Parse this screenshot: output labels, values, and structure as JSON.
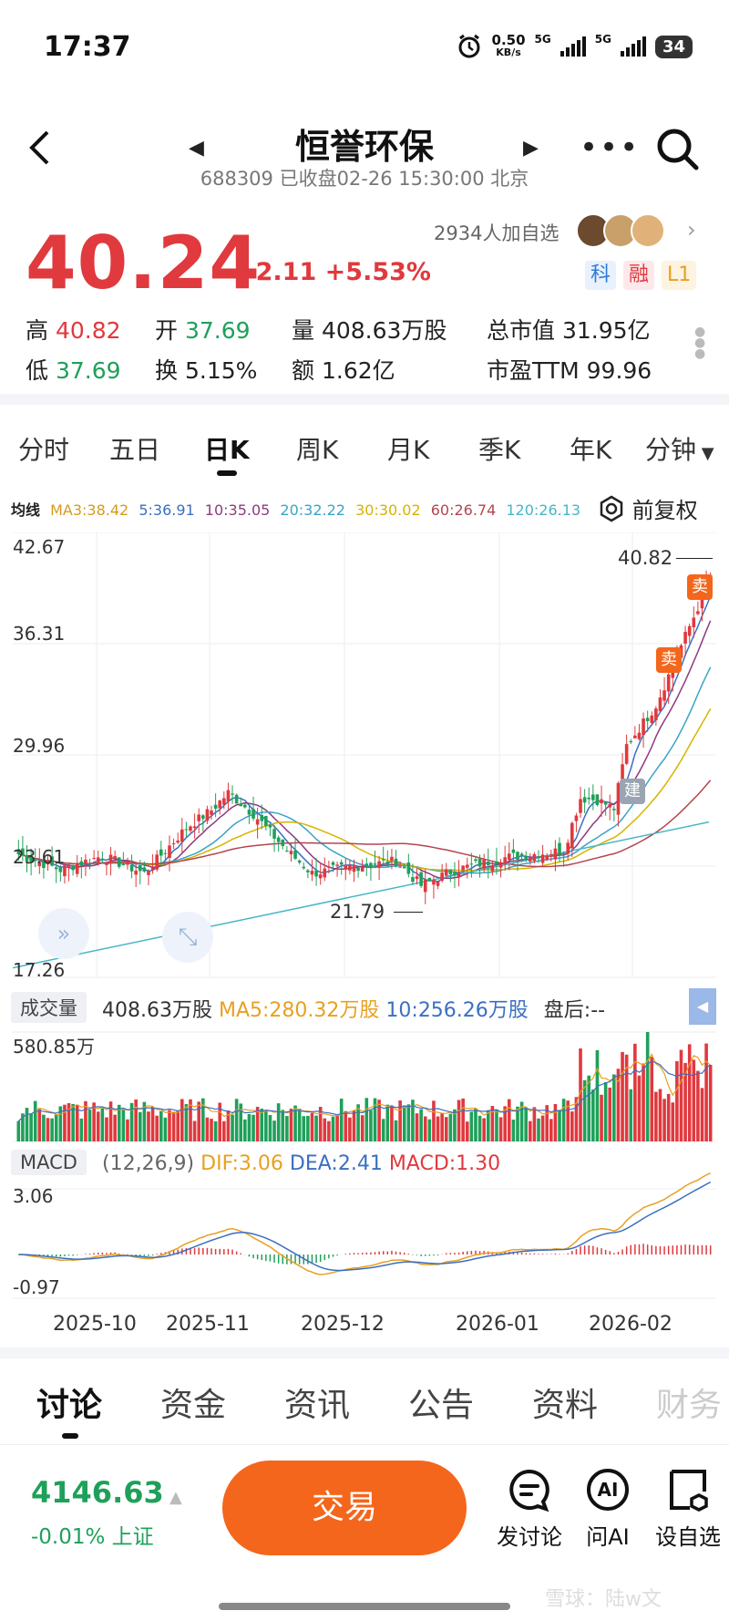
{
  "status": {
    "time": "17:37",
    "net_speed": "0.50",
    "net_unit": "KB/s",
    "sig1": "5G",
    "sig2": "5G",
    "battery": "34"
  },
  "header": {
    "title": "恒誉环保",
    "subtitle": "688309 已收盘02-26 15:30:00 北京"
  },
  "quote": {
    "price": "40.24",
    "change": "+2.11",
    "change_pct": "+5.53%",
    "followers": "2934人加自选",
    "tags": [
      "科",
      "融",
      "L1"
    ],
    "high_label": "高",
    "high": "40.82",
    "open_label": "开",
    "open": "37.69",
    "volume_label": "量",
    "volume": "408.63万股",
    "mcap_label": "总市值",
    "mcap": "31.95亿",
    "low_label": "低",
    "low": "37.69",
    "turnover_label": "换",
    "turnover": "5.15%",
    "amount_label": "额",
    "amount": "1.62亿",
    "pe_label": "市盈TTM",
    "pe": "99.96"
  },
  "kline_tabs": [
    "分时",
    "五日",
    "日K",
    "周K",
    "月K",
    "季K",
    "年K",
    "分钟"
  ],
  "kline_active": "日K",
  "ma_line": {
    "label": "均线",
    "items": [
      {
        "text": "MA3:38.42",
        "color": "#d49b1e"
      },
      {
        "text": "5:36.91",
        "color": "#3b6fc2"
      },
      {
        "text": "10:35.05",
        "color": "#8e3a7e"
      },
      {
        "text": "20:32.22",
        "color": "#3aa4c7"
      },
      {
        "text": "30:30.02",
        "color": "#d7b300"
      },
      {
        "text": "60:26.74",
        "color": "#b4454f"
      },
      {
        "text": "120:26.13",
        "color": "#46b6c8"
      }
    ],
    "adjust_label": "前复权"
  },
  "axis": {
    "y_top": "42.67",
    "y_2": "36.31",
    "y_3": "29.96",
    "y_4": "23.61",
    "y_bottom": "17.26",
    "max_label": "40.82",
    "min_label": "21.79",
    "buy_marker": "建",
    "sell_marker": "卖"
  },
  "volume": {
    "label": "成交量",
    "value": "408.63万股",
    "ma5": "MA5:280.32万股",
    "ma10": "10:256.26万股",
    "after": "盘后:--",
    "max": "580.85万"
  },
  "macd": {
    "label": "MACD",
    "params": "(12,26,9)",
    "dif": "DIF:3.06",
    "dea": "DEA:2.41",
    "macd": "MACD:1.30",
    "y_top": "3.06",
    "y_bottom": "-0.97"
  },
  "dates": [
    "2025-10",
    "2025-11",
    "2025-12",
    "2026-01",
    "2026-02"
  ],
  "bottom_tabs": [
    "讨论",
    "资金",
    "资讯",
    "公告",
    "资料",
    "财务"
  ],
  "index": {
    "value": "4146.63",
    "change": "-0.01% 上证"
  },
  "actions": {
    "trade": "交易",
    "discuss": "发讨论",
    "ai": "问AI",
    "watch": "设自选"
  },
  "watermark": "雪球：陆w文",
  "colors": {
    "up": "#e0393e",
    "down": "#1fa05a",
    "trade": "#f4661b"
  },
  "chart_data": {
    "type": "candlestick",
    "x": [
      "2025-10",
      "2025-11",
      "2025-12",
      "2026-01",
      "2026-02"
    ],
    "ylim": [
      17.26,
      42.67
    ],
    "high": 40.82,
    "low": 21.79,
    "last_close": 40.24
  }
}
